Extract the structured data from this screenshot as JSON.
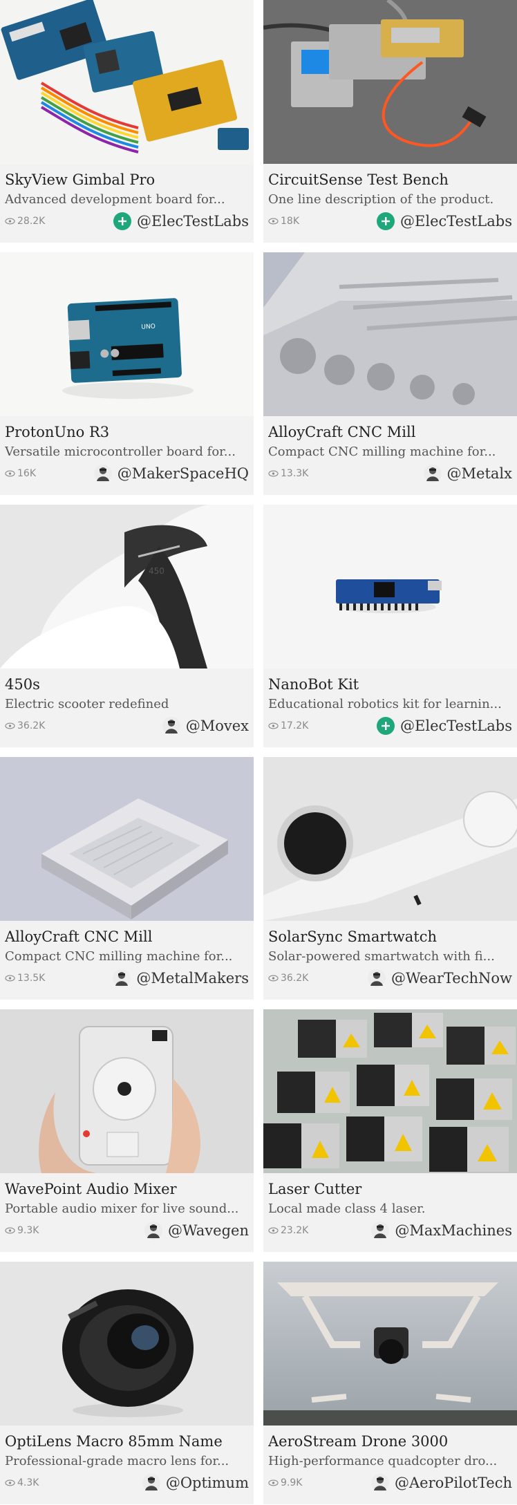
{
  "colors": {
    "card_bg": "#f2f2f2",
    "plus_avatar": "#1ea77a",
    "views_text": "#8a8a8a"
  },
  "cards": [
    {
      "title": "SkyView Gimbal Pro",
      "description": "Advanced development board for...",
      "views": "28.2K",
      "author": "@ElecTestLabs",
      "avatar": "plus-icon",
      "image": "arduino-boards"
    },
    {
      "title": "CircuitSense Test Bench",
      "description": "One line description of the product.",
      "views": "18K",
      "author": "@ElecTestLabs",
      "avatar": "plus-icon",
      "image": "laser-module"
    },
    {
      "title": "ProtonUno R3",
      "description": "Versatile microcontroller board for...",
      "views": "16K",
      "author": "@MakerSpaceHQ",
      "avatar": "user-avatar",
      "image": "arduino-uno"
    },
    {
      "title": "AlloyCraft CNC Mill",
      "description": "Compact CNC milling machine for...",
      "views": "13.3K",
      "author": "@Metalx",
      "avatar": "user-avatar",
      "image": "aluminum-block"
    },
    {
      "title": "450s",
      "description": "Electric scooter redefined",
      "views": "36.2K",
      "author": "@Movex",
      "avatar": "user-avatar",
      "image": "scooter"
    },
    {
      "title": "NanoBot Kit",
      "description": "Educational robotics kit for learnin...",
      "views": "17.2K",
      "author": "@ElecTestLabs",
      "avatar": "plus-icon",
      "image": "arduino-nano"
    },
    {
      "title": "AlloyCraft CNC Mill",
      "description": "Compact CNC milling machine for...",
      "views": "13.5K",
      "author": "@MetalMakers",
      "avatar": "user-avatar",
      "image": "aluminum-housing"
    },
    {
      "title": "SolarSync Smartwatch",
      "description": "Solar-powered smartwatch with fi...",
      "views": "36.2K",
      "author": "@WearTechNow",
      "avatar": "user-avatar",
      "image": "smartwatch"
    },
    {
      "title": "WavePoint Audio Mixer",
      "description": "Portable audio mixer for live sound...",
      "views": "9.3K",
      "author": "@Wavegen",
      "avatar": "user-avatar",
      "image": "audio-device"
    },
    {
      "title": "Laser Cutter",
      "description": "Local made class 4 laser.",
      "views": "23.2K",
      "author": "@MaxMachines",
      "avatar": "user-avatar",
      "image": "laser-modules"
    },
    {
      "title": "OptiLens Macro 85mm Name",
      "description": "Professional-grade macro lens for...",
      "views": "4.3K",
      "author": "@Optimum",
      "avatar": "user-avatar",
      "image": "camera-lens"
    },
    {
      "title": "AeroStream Drone 3000",
      "description": "High-performance quadcopter dro...",
      "views": "9.9K",
      "author": "@AeroPilotTech",
      "avatar": "user-avatar",
      "image": "drone"
    }
  ]
}
